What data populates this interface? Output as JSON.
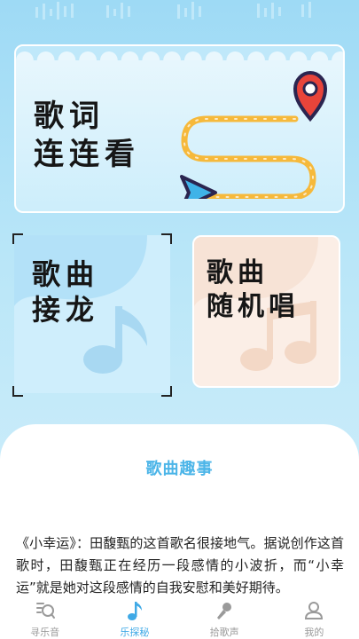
{
  "top_card": {
    "title": "歌词\n连连看"
  },
  "left_card": {
    "title": "歌曲\n接龙"
  },
  "right_card": {
    "title": "歌曲\n随机唱"
  },
  "story": {
    "heading": "歌曲趣事",
    "body": "《小幸运》：田馥甄的这首歌名很接地气。据说创作这首歌时，田馥甄正在经历一段感情的小波折，而“小幸运”就是她对这段感情的自我安慰和美好期待。"
  },
  "tabs": [
    {
      "label": "寻乐音",
      "icon": "search-music-icon",
      "active": false
    },
    {
      "label": "乐探秘",
      "icon": "music-note-icon",
      "active": true
    },
    {
      "label": "拾歌声",
      "icon": "microphone-icon",
      "active": false
    },
    {
      "label": "我的",
      "icon": "user-icon",
      "active": false
    }
  ],
  "colors": {
    "accent": "#3fa9e6",
    "route": "#f6b93b",
    "pin": "#e8443a"
  }
}
